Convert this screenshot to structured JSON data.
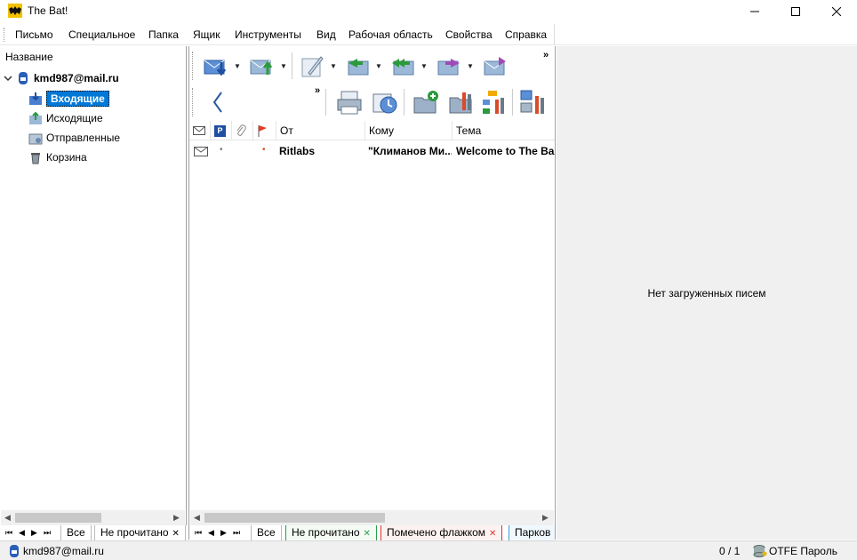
{
  "window": {
    "title": "The Bat!"
  },
  "menu": [
    "Письмо",
    "Специальное",
    "Папка",
    "Ящик",
    "Инструменты",
    "Вид",
    "Рабочая область",
    "Свойства",
    "Справка"
  ],
  "folders": {
    "header": "Название",
    "account": "kmd987@mail.ru",
    "items": [
      {
        "label": "Входящие",
        "icon": "inbox-icon",
        "selected": true
      },
      {
        "label": "Исходящие",
        "icon": "outbox-icon",
        "selected": false
      },
      {
        "label": "Отправленные",
        "icon": "sent-icon",
        "selected": false
      },
      {
        "label": "Корзина",
        "icon": "trash-icon",
        "selected": false
      }
    ]
  },
  "message_list": {
    "columns": {
      "from": "От",
      "to": "Кому",
      "subject": "Тема"
    },
    "rows": [
      {
        "from": "Ritlabs",
        "to": "\"Климанов Ми...",
        "subject": "Welcome to The Ba"
      }
    ]
  },
  "folder_tabs": {
    "all": "Все",
    "unread": "Не прочитано"
  },
  "list_tabs": {
    "all": "Все",
    "unread": "Не прочитано",
    "flagged": "Помечено флажком",
    "parked": "Парков"
  },
  "preview": {
    "empty_text": "Нет загруженных писем"
  },
  "status": {
    "account": "kmd987@mail.ru",
    "count": "0 / 1",
    "otfe": "OTFE Пароль"
  },
  "colors": {
    "selection": "#0078d7",
    "unread_tab": "#2e9e4f",
    "flag_tab": "#d9342b",
    "parked_tab": "#3aa0d8"
  }
}
